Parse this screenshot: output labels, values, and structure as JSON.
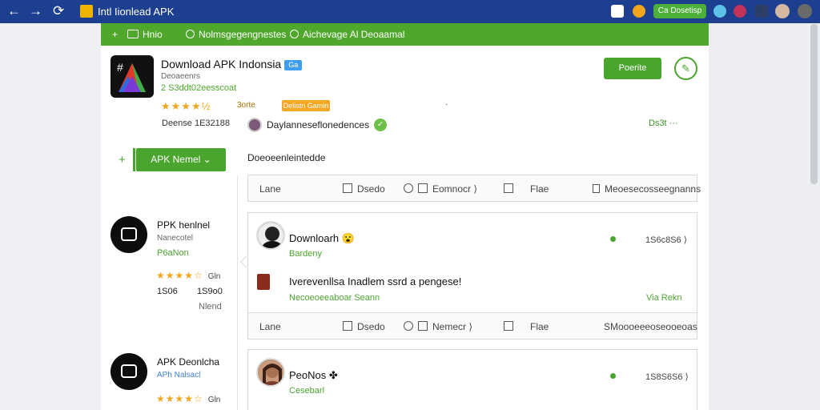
{
  "browser": {
    "back": "←",
    "forward": "→",
    "reload": "⟳",
    "tab_title": "Intl Iionlead APK",
    "pill_label": "Ca Dosetisp"
  },
  "nav": {
    "home": "Hnio",
    "item2": "Nolmsgegengnestes",
    "item3": "Aichevage Al Deoaamal"
  },
  "app": {
    "name": "Download APK Indonsia",
    "badge": "Ga",
    "developer": "Deoaeenrs",
    "size": "2 S3ddt02eesscoat",
    "stars": "★★★★½",
    "rating_note": "3orte",
    "tag": "Delistn Gamin",
    "dot": "·",
    "version": "Deense 1E32188",
    "install_label": "Poerite",
    "edit_icon": "✎"
  },
  "dev_line": {
    "name": "Daylanneseflonedences"
  },
  "dealer": "Ds3t ···",
  "apk_button": "APK Nemel ⌄",
  "side_plus": "+",
  "desc_title": "Doeoeenleintedde",
  "left_cards": [
    {
      "name": "PPK henlnel",
      "sub": "Nanecotel",
      "green": "P6aNon",
      "stars": "★★★★☆",
      "stars_note": "Gln",
      "meta1": "1S06",
      "meta2": "1S9o0",
      "meta3": "Nlend"
    },
    {
      "name": "APK Deonlcha",
      "sub": "APh Nalsacl",
      "stars": "★★★★☆",
      "stars_note": "Gln"
    }
  ],
  "action_rows": [
    {
      "lane": "Lane",
      "a2": "Dsedo",
      "a3": "Eomnocr ⟩",
      "a4": "Flae",
      "a5": "Meoesecosseegnanns"
    },
    {
      "lane": "Lane",
      "a2": "Dsedo",
      "a3": "Nemecr ⟩",
      "a4": "Flae",
      "a5": "SMoooeeeoseooeoas"
    }
  ],
  "posts": [
    {
      "name": "Downloarh 😮",
      "green": "Bardeny",
      "count": "1S6c8S6 ⟩",
      "body": "Iverevenllsa Inadlem ssrd a pengese!",
      "tag": "Necoeoeeaboar Seann",
      "via": "Via Rekn"
    },
    {
      "name": "PeoNos ✤",
      "green": "Cesebarl",
      "count": "1S8S6S6 ⟩"
    }
  ],
  "colors": {
    "brand_blue": "#1d3f8f",
    "accent_green": "#4fa82c",
    "star": "#f2a61c"
  }
}
